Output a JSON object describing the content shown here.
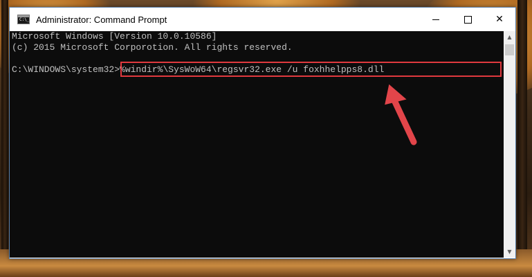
{
  "window": {
    "title": "Administrator: Command Prompt",
    "icon_label": "C:\\_",
    "minimize_glyph": "minimize-icon",
    "maximize_glyph": "maximize-icon",
    "close_glyph": "✕"
  },
  "console": {
    "lines": [
      "Microsoft Windows [Version 10.0.10586]",
      "(c) 2015 Microsoft Corporotion. All rights reserved.",
      ""
    ],
    "prompt": "C:\\WINDOWS\\system32>",
    "command": "%windir%\\SysWoW64\\regsvr32.exe /u foxhhelpps8.dll"
  },
  "scrollbar": {
    "up_arrow": "▲",
    "down_arrow": "▼"
  },
  "colors": {
    "highlight": "#e0393e",
    "arrow": "#e2454a",
    "console_bg": "#0c0c0c",
    "console_fg": "#c0c0c0"
  }
}
